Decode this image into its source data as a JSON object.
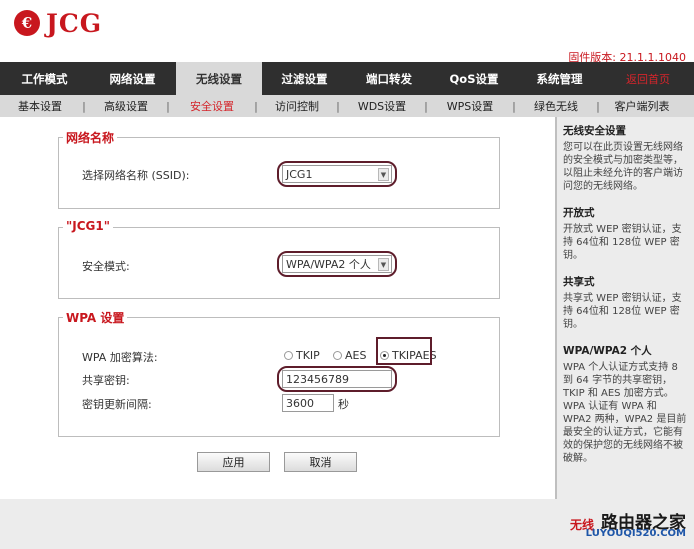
{
  "brand": {
    "mark": "€",
    "name": "JCG"
  },
  "firmware": "固件版本: 21.1.1.1040",
  "main_nav": [
    {
      "label": "工作模式"
    },
    {
      "label": "网络设置"
    },
    {
      "label": "无线设置",
      "active": true
    },
    {
      "label": "过滤设置"
    },
    {
      "label": "端口转发"
    },
    {
      "label": "QoS设置"
    },
    {
      "label": "系统管理"
    },
    {
      "label": "返回首页"
    }
  ],
  "sub_nav": [
    {
      "label": "基本设置"
    },
    {
      "label": "高级设置"
    },
    {
      "label": "安全设置",
      "active": true
    },
    {
      "label": "访问控制"
    },
    {
      "label": "WDS设置"
    },
    {
      "label": "WPS设置"
    },
    {
      "label": "绿色无线"
    },
    {
      "label": "客户端列表"
    }
  ],
  "network_section": {
    "legend": "网络名称",
    "ssid_label": "选择网络名称 (SSID):",
    "ssid_value": "JCG1"
  },
  "jcg1_section": {
    "legend": "\"JCG1\"",
    "mode_label": "安全模式:",
    "mode_value": "WPA/WPA2 个人"
  },
  "wpa_section": {
    "legend": "WPA 设置",
    "algo_label": "WPA 加密算法:",
    "options": [
      "TKIP",
      "AES",
      "TKIPAES"
    ],
    "selected_option": "TKIPAES",
    "key_label": "共享密钥:",
    "key_value": "123456789",
    "interval_label": "密钥更新间隔:",
    "interval_value": "3600",
    "interval_unit": "秒"
  },
  "buttons": {
    "apply": "应用",
    "cancel": "取消"
  },
  "help": [
    {
      "title": "无线安全设置",
      "body": "您可以在此页设置无线网络的安全模式与加密类型等，以阻止未经允许的客户端访问您的无线网络。"
    },
    {
      "title": "开放式",
      "body": "开放式 WEP 密钥认证，支持 64位和 128位 WEP 密钥。"
    },
    {
      "title": "共享式",
      "body": "共享式 WEP 密钥认证，支持 64位和 128位 WEP 密钥。"
    },
    {
      "title": "WPA/WPA2 个人",
      "body": "WPA 个人认证方式支持 8 到 64 字节的共享密钥，TKIP 和 AES 加密方式。WPA 认证有 WPA 和 WPA2 两种，WPA2 是目前最安全的认证方式，它能有效的保护您的无线网络不被破解。"
    }
  ],
  "watermark": {
    "left": "无线",
    "main": "路由器之家",
    "url": "LUYOUQI520.COM"
  },
  "colors": {
    "accent": "#c8171e",
    "nav_bg": "#2f2f2f",
    "subnav_bg": "#d9d9d9",
    "ring": "#5e1d2b"
  }
}
